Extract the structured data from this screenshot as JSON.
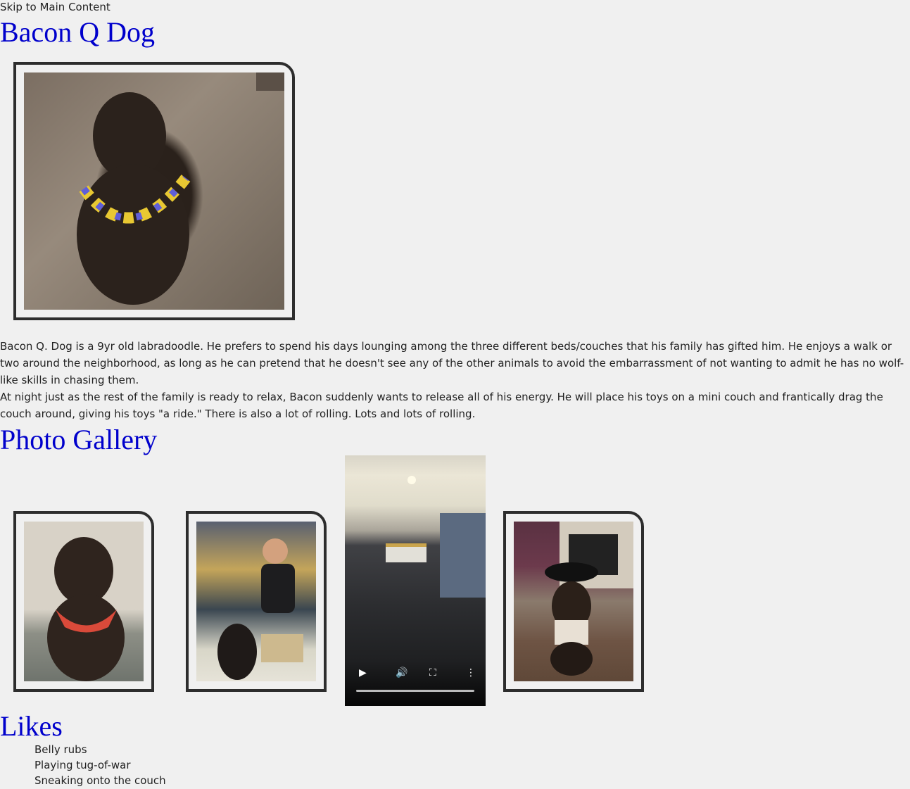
{
  "skip_link": "Skip to Main Content",
  "page_title": "Bacon Q Dog",
  "bio": {
    "paragraph1": "Bacon Q. Dog is a 9yr old labradoodle. He prefers to spend his days lounging among the three different beds/couches that his family has gifted him. He enjoys a walk or two around the neighborhood, as long as he can pretend that he doesn't see any of the other animals to avoid the embarrassment of not wanting to admit he has no wolf-like skills in chasing them.",
    "paragraph2": "At night just as the rest of the family is ready to relax, Bacon suddenly wants to release all of his energy. He will place his toys on a mini couch and frantically drag the couch around, giving his toys \"a ride.\" There is also a lot of rolling. Lots and lots of rolling."
  },
  "gallery": {
    "title": "Photo Gallery",
    "video_controls": [
      "play-icon",
      "volume-icon",
      "fullscreen-icon",
      "more-options-icon"
    ]
  },
  "likes": {
    "title": "Likes",
    "items": [
      "Belly rubs",
      "Playing tug-of-war",
      "Sneaking onto the couch"
    ]
  },
  "colors": {
    "heading": "#0000cc",
    "frame_border": "#2d2d2d",
    "background": "#f0f0f0"
  }
}
